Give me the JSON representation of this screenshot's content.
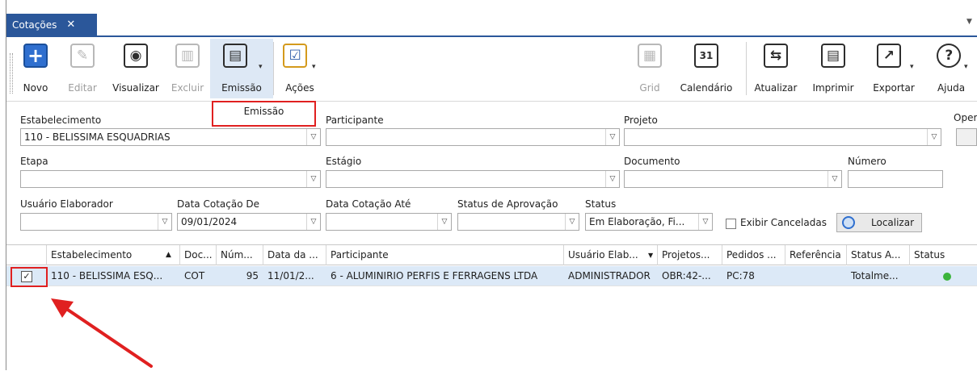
{
  "tab": {
    "label": "Cotações",
    "close": "✕",
    "menu_caret": "▼"
  },
  "toolbar": {
    "novo": "Novo",
    "editar": "Editar",
    "visualizar": "Visualizar",
    "excluir": "Excluir",
    "emissao": "Emissão",
    "acoes": "Ações",
    "grid": "Grid",
    "calendario": "Calendário",
    "calendar_day": "31",
    "atualizar": "Atualizar",
    "imprimir": "Imprimir",
    "exportar": "Exportar",
    "ajuda": "Ajuda"
  },
  "popup": {
    "emissao_item": "Emissão"
  },
  "filters": {
    "estabelecimento_label": "Estabelecimento",
    "estabelecimento_value": "110 - BELISSIMA ESQUADRIAS",
    "participante_label": "Participante",
    "participante_value": "",
    "projeto_label": "Projeto",
    "projeto_value": "",
    "operacao_label": "Oper",
    "etapa_label": "Etapa",
    "etapa_value": "",
    "estagio_label": "Estágio",
    "estagio_value": "",
    "documento_label": "Documento",
    "documento_value": "",
    "numero_label": "Número",
    "numero_value": "",
    "usuario_label": "Usuário Elaborador",
    "usuario_value": "",
    "data_de_label": "Data Cotação De",
    "data_de_value": "09/01/2024",
    "data_ate_label": "Data Cotação Até",
    "data_ate_value": "",
    "status_aprov_label": "Status de Aprovação",
    "status_aprov_value": "",
    "status_label": "Status",
    "status_value": "Em Elaboração, Fi...",
    "exibir_canceladas": "Exibir Canceladas",
    "localizar": "Localizar"
  },
  "grid": {
    "headers": {
      "estabelecimento": "Estabelecimento",
      "sort_indicator": "▲",
      "documento": "Doc...",
      "numero": "Núm...",
      "data": "Data da ...",
      "participante": "Participante",
      "usuario": "Usuário Elab...",
      "filter_indicator": "▼",
      "projetos": "Projetos...",
      "pedidos": "Pedidos ...",
      "referencia": "Referência",
      "status_aprov": "Status A...",
      "status": "Status"
    },
    "rows": [
      {
        "checked": "✓",
        "estabelecimento": "110 - BELISSIMA ESQ...",
        "documento": "COT",
        "numero": "95",
        "data": "11/01/2...",
        "participante": "6 - ALUMINIRIO PERFIS E FERRAGENS LTDA",
        "usuario": "ADMINISTRADOR",
        "projetos": "OBR:42-...",
        "pedidos": "PC:78",
        "referencia": "",
        "status_aprov": "Totalme...",
        "status_color": "#3cb43c"
      }
    ]
  },
  "colors": {
    "accent": "#2b579a",
    "highlight": "#e02020",
    "selected_row": "#dce9f7"
  }
}
